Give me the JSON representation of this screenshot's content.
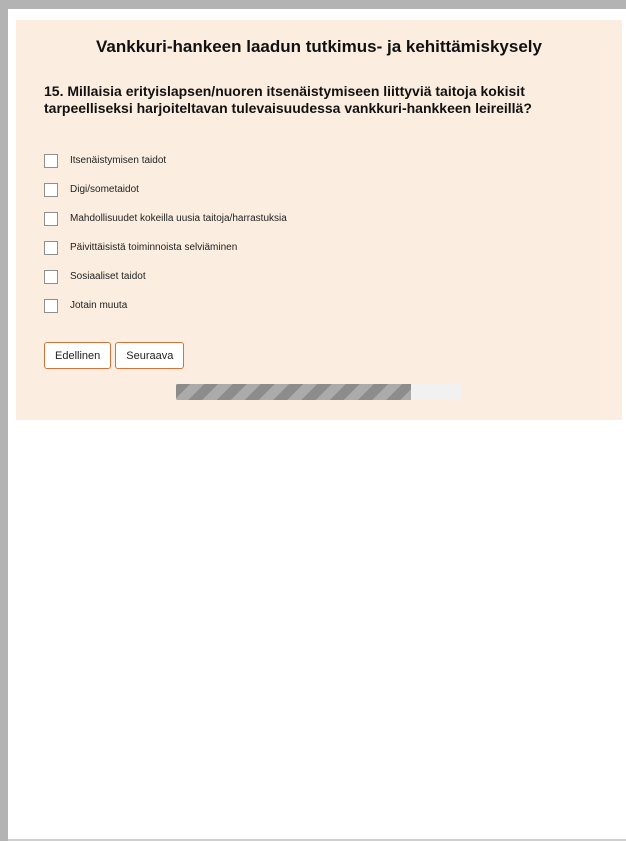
{
  "survey": {
    "title": "Vankkuri-hankeen laadun tutkimus- ja kehittämiskysely",
    "question": "15. Millaisia erityislapsen/nuoren itsenäistymiseen liittyviä taitoja kokisit tarpeelliseksi harjoiteltavan tulevaisuudessa vankkuri-hankkeen leireillä?",
    "options": [
      {
        "label": "Itsenäistymisen taidot",
        "checked": false
      },
      {
        "label": "Digi/sometaidot",
        "checked": false
      },
      {
        "label": "Mahdollisuudet kokeilla uusia taitoja/harrastuksia",
        "checked": false
      },
      {
        "label": "Päivittäisistä toiminnoista selviäminen",
        "checked": false
      },
      {
        "label": "Sosiaaliset taidot",
        "checked": false
      },
      {
        "label": "Jotain muuta",
        "checked": false
      }
    ],
    "nav": {
      "previous_label": "Edellinen",
      "next_label": "Seuraava"
    },
    "progress": {
      "fraction": 0.82
    },
    "colors": {
      "panel_background": "#fbeee0",
      "button_border": "#d3733b",
      "progress_fill": "#8c8c8c",
      "progress_track": "#f1f1f1"
    }
  }
}
